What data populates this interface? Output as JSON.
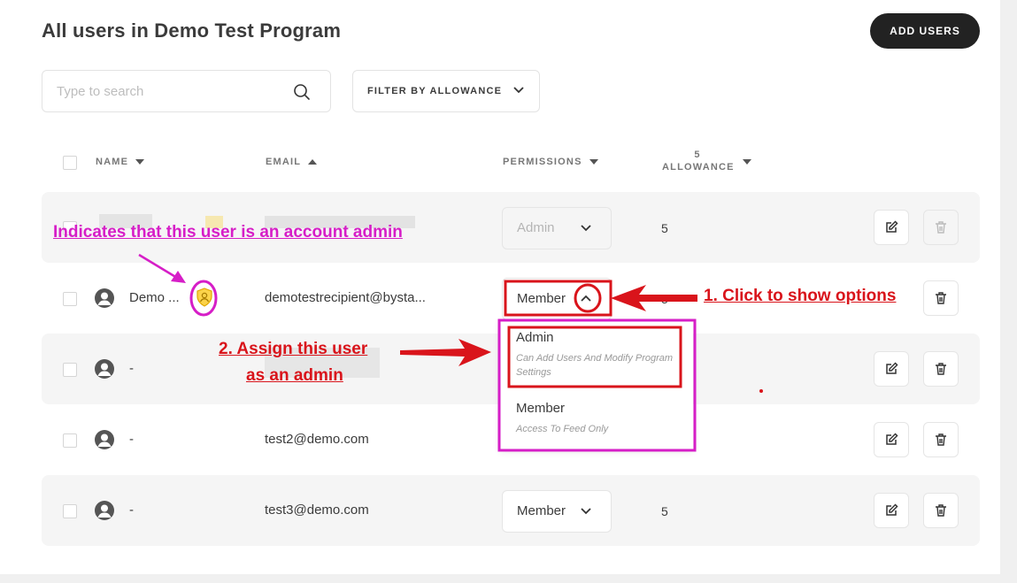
{
  "page": {
    "title": "All users in Demo Test Program"
  },
  "toolbar": {
    "add_users_label": "ADD USERS"
  },
  "search": {
    "placeholder": "Type to search"
  },
  "filter": {
    "label": "FILTER BY ALLOWANCE"
  },
  "table": {
    "headers": {
      "name": "NAME",
      "email": "EMAIL",
      "permissions": "PERMISSIONS",
      "allowance_count": "5",
      "allowance": "ALLOWANCE"
    },
    "rows": [
      {
        "name": "",
        "email": "",
        "permission": "Admin",
        "allowance": "5"
      },
      {
        "name": "Demo ...",
        "email": "demotestrecipient@bysta...",
        "permission": "Member",
        "allowance": "5"
      },
      {
        "name": "-",
        "email": "",
        "permission": "",
        "allowance": ""
      },
      {
        "name": "-",
        "email": "test2@demo.com",
        "permission": "",
        "allowance": ""
      },
      {
        "name": "-",
        "email": "test3@demo.com",
        "permission": "Member",
        "allowance": "5"
      }
    ]
  },
  "dropdown": {
    "options": [
      {
        "title": "Admin",
        "description": "Can Add Users And Modify Program Settings"
      },
      {
        "title": "Member",
        "description": "Access To Feed Only"
      }
    ]
  },
  "annotations": {
    "admin_indicator": "Indicates that this user is an account admin",
    "step1": "1. Click to show options",
    "step2_line1": "2. Assign this user",
    "step2_line2": "as an admin"
  },
  "colors": {
    "annotation_magenta": "#d61ec7",
    "annotation_red": "#d9141b",
    "admin_badge": "#f2b600",
    "primary_button": "#222222"
  },
  "icons": [
    "search-icon",
    "chevron-down-icon",
    "chevron-up-icon",
    "sort-arrow-icon",
    "user-avatar-icon",
    "admin-shield-icon",
    "edit-icon",
    "trash-icon"
  ]
}
